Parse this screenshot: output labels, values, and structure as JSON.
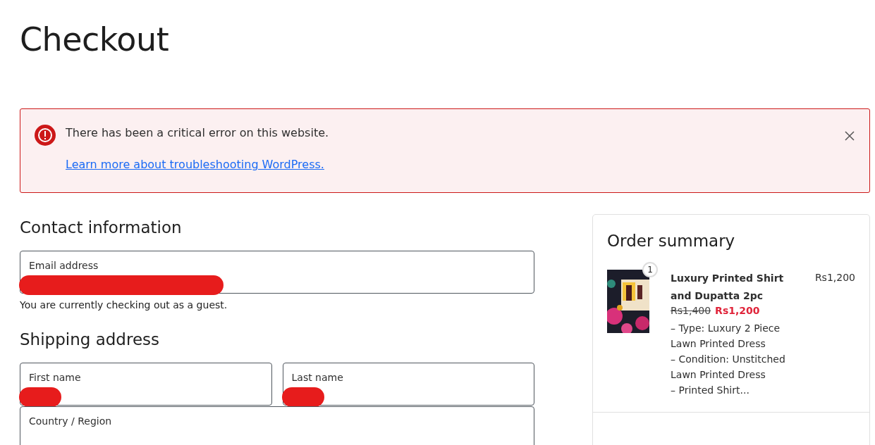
{
  "page_title": "Checkout",
  "notice": {
    "message": "There has been a critical error on this website.",
    "link": "Learn more about troubleshooting WordPress."
  },
  "contact": {
    "heading": "Contact information",
    "fields": [
      {
        "label": "Email address",
        "redacted": true
      }
    ],
    "note": "You are currently checking out as a guest."
  },
  "shipping": {
    "heading": "Shipping address",
    "rows": [
      [
        {
          "label": "First name",
          "redacted": true
        },
        {
          "label": "Last name",
          "redacted": true
        }
      ],
      [
        {
          "label": "Country / Region",
          "redacted": false
        }
      ]
    ]
  },
  "order_summary": {
    "heading": "Order summary",
    "items": [
      {
        "kind": "picture",
        "quantity": "1",
        "name": "Luxury Printed Shirt and Dupatta 2pc",
        "old_price": "Rs1,400",
        "sale_price": "Rs1,200",
        "total": "Rs1,200",
        "details": [
          "– Type: Luxury 2 Piece Lawn Printed Dress",
          "– Condition: Unstitched Lawn Printed Dress",
          "– Printed Shirt..."
        ]
      }
    ]
  }
}
